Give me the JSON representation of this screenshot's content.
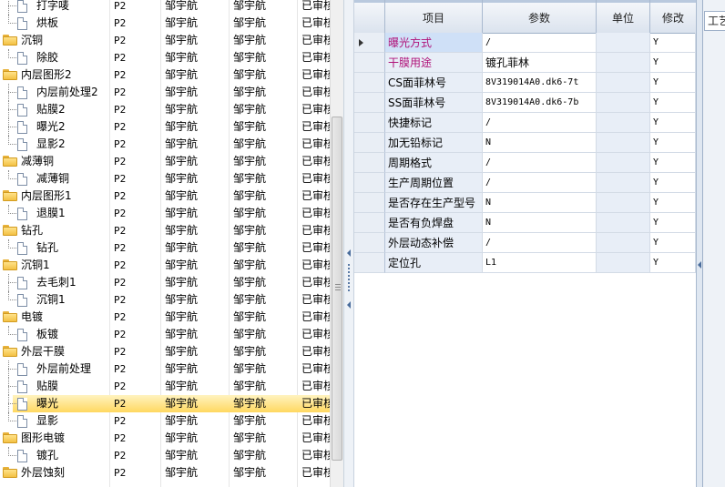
{
  "tree": {
    "rows": [
      {
        "name": "打字唛",
        "level": "P2",
        "a": "邹宇航",
        "b": "邹宇航",
        "status": "已审核",
        "type": "doc",
        "indent": 1,
        "branch": "mid",
        "selected": false
      },
      {
        "name": "烘板",
        "level": "P2",
        "a": "邹宇航",
        "b": "邹宇航",
        "status": "已审核",
        "type": "doc",
        "indent": 1,
        "branch": "last",
        "selected": false
      },
      {
        "name": "沉铜",
        "level": "P2",
        "a": "邹宇航",
        "b": "邹宇航",
        "status": "已审核",
        "type": "folder",
        "indent": 0,
        "selected": false
      },
      {
        "name": "除胶",
        "level": "P2",
        "a": "邹宇航",
        "b": "邹宇航",
        "status": "已审核",
        "type": "doc",
        "indent": 1,
        "branch": "last",
        "selected": false
      },
      {
        "name": "内层图形2",
        "level": "P2",
        "a": "邹宇航",
        "b": "邹宇航",
        "status": "已审核",
        "type": "folder",
        "indent": 0,
        "selected": false
      },
      {
        "name": "内层前处理2",
        "level": "P2",
        "a": "邹宇航",
        "b": "邹宇航",
        "status": "已审核",
        "type": "doc",
        "indent": 1,
        "branch": "mid",
        "selected": false
      },
      {
        "name": "贴膜2",
        "level": "P2",
        "a": "邹宇航",
        "b": "邹宇航",
        "status": "已审核",
        "type": "doc",
        "indent": 1,
        "branch": "mid",
        "selected": false
      },
      {
        "name": "曝光2",
        "level": "P2",
        "a": "邹宇航",
        "b": "邹宇航",
        "status": "已审核",
        "type": "doc",
        "indent": 1,
        "branch": "mid",
        "selected": false
      },
      {
        "name": "显影2",
        "level": "P2",
        "a": "邹宇航",
        "b": "邹宇航",
        "status": "已审核",
        "type": "doc",
        "indent": 1,
        "branch": "last",
        "selected": false
      },
      {
        "name": "减薄铜",
        "level": "P2",
        "a": "邹宇航",
        "b": "邹宇航",
        "status": "已审核",
        "type": "folder",
        "indent": 0,
        "selected": false
      },
      {
        "name": "减薄铜",
        "level": "P2",
        "a": "邹宇航",
        "b": "邹宇航",
        "status": "已审核",
        "type": "doc",
        "indent": 1,
        "branch": "last",
        "selected": false
      },
      {
        "name": "内层图形1",
        "level": "P2",
        "a": "邹宇航",
        "b": "邹宇航",
        "status": "已审核",
        "type": "folder",
        "indent": 0,
        "selected": false
      },
      {
        "name": "退膜1",
        "level": "P2",
        "a": "邹宇航",
        "b": "邹宇航",
        "status": "已审核",
        "type": "doc",
        "indent": 1,
        "branch": "last",
        "selected": false
      },
      {
        "name": "钻孔",
        "level": "P2",
        "a": "邹宇航",
        "b": "邹宇航",
        "status": "已审核",
        "type": "folder",
        "indent": 0,
        "selected": false
      },
      {
        "name": "钻孔",
        "level": "P2",
        "a": "邹宇航",
        "b": "邹宇航",
        "status": "已审核",
        "type": "doc",
        "indent": 1,
        "branch": "last",
        "selected": false
      },
      {
        "name": "沉铜1",
        "level": "P2",
        "a": "邹宇航",
        "b": "邹宇航",
        "status": "已审核",
        "type": "folder",
        "indent": 0,
        "selected": false
      },
      {
        "name": "去毛刺1",
        "level": "P2",
        "a": "邹宇航",
        "b": "邹宇航",
        "status": "已审核",
        "type": "doc",
        "indent": 1,
        "branch": "mid",
        "selected": false
      },
      {
        "name": "沉铜1",
        "level": "P2",
        "a": "邹宇航",
        "b": "邹宇航",
        "status": "已审核",
        "type": "doc",
        "indent": 1,
        "branch": "last",
        "selected": false
      },
      {
        "name": "电镀",
        "level": "P2",
        "a": "邹宇航",
        "b": "邹宇航",
        "status": "已审核",
        "type": "folder",
        "indent": 0,
        "selected": false
      },
      {
        "name": "板镀",
        "level": "P2",
        "a": "邹宇航",
        "b": "邹宇航",
        "status": "已审核",
        "type": "doc",
        "indent": 1,
        "branch": "last",
        "selected": false
      },
      {
        "name": "外层干膜",
        "level": "P2",
        "a": "邹宇航",
        "b": "邹宇航",
        "status": "已审核",
        "type": "folder",
        "indent": 0,
        "selected": false
      },
      {
        "name": "外层前处理",
        "level": "P2",
        "a": "邹宇航",
        "b": "邹宇航",
        "status": "已审核",
        "type": "doc",
        "indent": 1,
        "branch": "mid",
        "selected": false
      },
      {
        "name": "贴膜",
        "level": "P2",
        "a": "邹宇航",
        "b": "邹宇航",
        "status": "已审核",
        "type": "doc",
        "indent": 1,
        "branch": "mid",
        "selected": false
      },
      {
        "name": "曝光",
        "level": "P2",
        "a": "邹宇航",
        "b": "邹宇航",
        "status": "已审核",
        "type": "doc",
        "indent": 1,
        "branch": "mid",
        "selected": true
      },
      {
        "name": "显影",
        "level": "P2",
        "a": "邹宇航",
        "b": "邹宇航",
        "status": "已审核",
        "type": "doc",
        "indent": 1,
        "branch": "last",
        "selected": false
      },
      {
        "name": "图形电镀",
        "level": "P2",
        "a": "邹宇航",
        "b": "邹宇航",
        "status": "已审核",
        "type": "folder",
        "indent": 0,
        "selected": false
      },
      {
        "name": "镀孔",
        "level": "P2",
        "a": "邹宇航",
        "b": "邹宇航",
        "status": "已审核",
        "type": "doc",
        "indent": 1,
        "branch": "last",
        "selected": false
      },
      {
        "name": "外层蚀刻",
        "level": "P2",
        "a": "邹宇航",
        "b": "邹宇航",
        "status": "已审核",
        "type": "folder",
        "indent": 0,
        "selected": false
      }
    ]
  },
  "grid": {
    "headers": {
      "item": "项目",
      "param": "参数",
      "unit": "单位",
      "modify": "修改"
    },
    "rows": [
      {
        "item": "曝光方式",
        "param": "/",
        "unit": "",
        "modify": "Y",
        "current": true,
        "highlight": true
      },
      {
        "item": "干膜用途",
        "param": "镀孔菲林",
        "unit": "",
        "modify": "Y",
        "current": false,
        "highlight": true
      },
      {
        "item": "CS面菲林号",
        "param": "8V319014A0.dk6-7t",
        "unit": "",
        "modify": "Y",
        "current": false,
        "highlight": false
      },
      {
        "item": "SS面菲林号",
        "param": "8V319014A0.dk6-7b",
        "unit": "",
        "modify": "Y",
        "current": false,
        "highlight": false
      },
      {
        "item": "快捷标记",
        "param": "/",
        "unit": "",
        "modify": "Y",
        "current": false,
        "highlight": false
      },
      {
        "item": "加无铅标记",
        "param": "N",
        "unit": "",
        "modify": "Y",
        "current": false,
        "highlight": false
      },
      {
        "item": "周期格式",
        "param": "/",
        "unit": "",
        "modify": "Y",
        "current": false,
        "highlight": false
      },
      {
        "item": "生产周期位置",
        "param": "/",
        "unit": "",
        "modify": "Y",
        "current": false,
        "highlight": false
      },
      {
        "item": "是否存在生产型号",
        "param": "N",
        "unit": "",
        "modify": "Y",
        "current": false,
        "highlight": false
      },
      {
        "item": "是否有负焊盘",
        "param": "N",
        "unit": "",
        "modify": "Y",
        "current": false,
        "highlight": false
      },
      {
        "item": "外层动态补偿",
        "param": "/",
        "unit": "",
        "modify": "Y",
        "current": false,
        "highlight": false
      },
      {
        "item": "定位孔",
        "param": "L1",
        "unit": "",
        "modify": "Y",
        "current": false,
        "highlight": false
      }
    ]
  },
  "right_tab": {
    "label": "工艺"
  },
  "colors": {
    "selected_row": "#ffd860",
    "highlight_text": "#b0137a",
    "header_bg": "#dbe3ee"
  }
}
